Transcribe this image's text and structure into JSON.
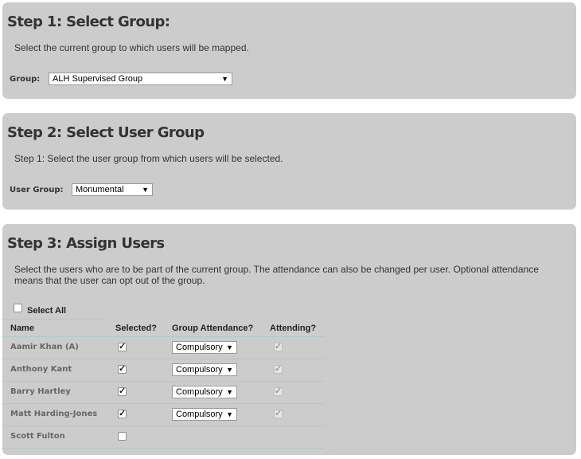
{
  "step1": {
    "title": "Step 1: Select Group:",
    "description": "Select the current group to which users will be mapped.",
    "group_label": "Group:",
    "group_value": "ALH Supervised Group"
  },
  "step2": {
    "title": "Step 2: Select User Group",
    "description": "Step 1: Select the user group from which users will be selected.",
    "user_group_label": "User Group:",
    "user_group_value": "Monumental"
  },
  "step3": {
    "title": "Step 3: Assign Users",
    "description_line1": "Select the users who are to be part of the current group. The attendance can also be changed per user. Optional attendance",
    "description_line2": "means that the user can opt out of the group.",
    "select_all_label": "Select All",
    "columns": {
      "name": "Name",
      "selected": "Selected?",
      "group_attendance": "Group Attendance?",
      "attending": "Attending?"
    },
    "users": [
      {
        "name": "Aamir Khan (A)",
        "selected": true,
        "attendance": "Compulsory",
        "attending": true
      },
      {
        "name": "Anthony Kant",
        "selected": true,
        "attendance": "Compulsory",
        "attending": true
      },
      {
        "name": "Barry Hartley",
        "selected": true,
        "attendance": "Compulsory",
        "attending": true
      },
      {
        "name": "Matt Harding-Jones",
        "selected": true,
        "attendance": "Compulsory",
        "attending": true
      },
      {
        "name": "Scott Fulton",
        "selected": false,
        "attendance": "",
        "attending": false
      }
    ]
  },
  "icons": {
    "dropdown": "chevron-down-icon",
    "check": "checkmark-icon"
  },
  "colors": {
    "panel_bg": "#cccccc",
    "heading": "#333333",
    "row_divider": "#b3c6cf"
  }
}
